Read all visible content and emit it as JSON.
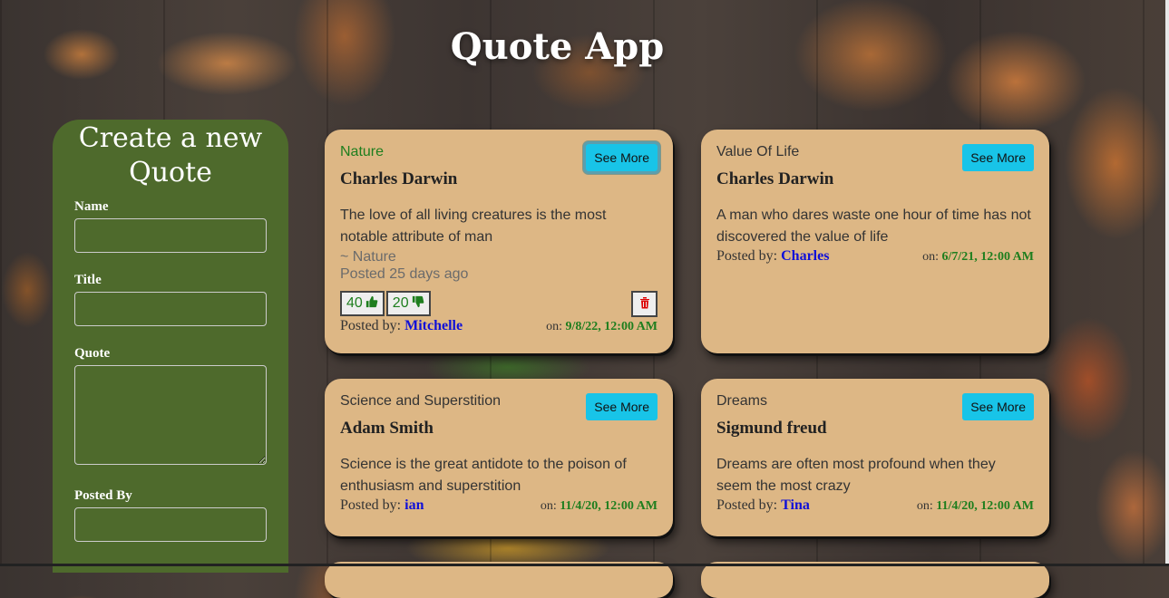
{
  "app": {
    "title": "Quote App"
  },
  "form": {
    "heading": "Create a new Quote",
    "name_label": "Name",
    "title_label": "Title",
    "quote_label": "Quote",
    "posted_by_label": "Posted By",
    "name_value": "",
    "title_value": "",
    "quote_value": "",
    "posted_by_value": ""
  },
  "cards": [
    {
      "category": "Nature",
      "see_more": "See More",
      "author": "Charles Darwin",
      "quote": "The love of all living creatures is the most notable attribute of man",
      "tag": "~ Nature",
      "posted_ago": "Posted 25 days ago",
      "likes": "40",
      "dislikes": "20",
      "posted_by_prefix": "Posted by:",
      "poster": "Mitchelle",
      "on_prefix": "on:",
      "date": "9/8/22, 12:00 AM"
    },
    {
      "category": "Value Of Life",
      "see_more": "See More",
      "author": "Charles Darwin",
      "quote": "A man who dares waste one hour of time has not discovered the value of life",
      "posted_by_prefix": "Posted by:",
      "poster": "Charles",
      "on_prefix": "on:",
      "date": "6/7/21, 12:00 AM"
    },
    {
      "category": "Science and Superstition",
      "see_more": "See More",
      "author": "Adam Smith",
      "quote": "Science is the great antidote to the poison of enthusiasm and superstition",
      "posted_by_prefix": "Posted by:",
      "poster": "ian",
      "on_prefix": "on:",
      "date": "11/4/20, 12:00 AM"
    },
    {
      "category": "Dreams",
      "see_more": "See More",
      "author": "Sigmund freud",
      "quote": "Dreams are often most profound when they seem the most crazy",
      "posted_by_prefix": "Posted by:",
      "poster": "Tina",
      "on_prefix": "on:",
      "date": "11/4/20, 12:00 AM"
    }
  ],
  "colors": {
    "card_bg": "#ddb785",
    "form_bg": "#4e6a2c",
    "button_bg": "#18c4e8",
    "poster_name": "#1010d8",
    "date_green": "#1e7e1e"
  }
}
